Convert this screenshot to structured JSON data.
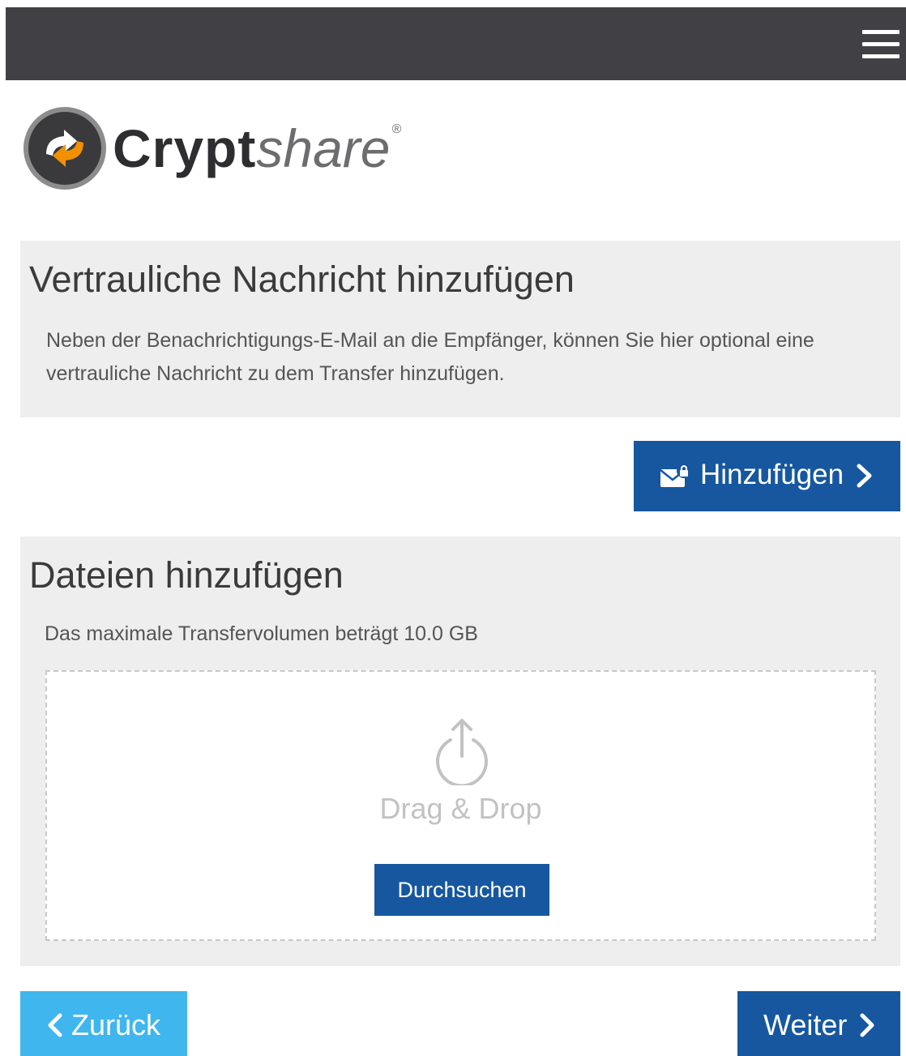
{
  "header": {
    "menu_icon": "hamburger-menu-icon",
    "background": "#414145"
  },
  "logo": {
    "brand_bold": "Crypt",
    "brand_light": "share",
    "registered": "®",
    "mark_icon": "cryptshare-logo-icon"
  },
  "message_section": {
    "title": "Vertrauliche Nachricht hinzufügen",
    "description": "Neben der Benachrichtigungs-E-Mail an die Empfänger, können Sie hier optional eine vertrauliche Nachricht zu dem Transfer hinzufügen.",
    "add_button": {
      "label": "Hinzufügen",
      "icon": "envelope-lock-icon",
      "chevron": "chevron-right-icon"
    }
  },
  "files_section": {
    "title": "Dateien hinzufügen",
    "description": "Das maximale Transfervolumen beträgt 10.0 GB",
    "dropzone": {
      "icon": "upload-icon",
      "text": "Drag & Drop",
      "browse_label": "Durchsuchen"
    }
  },
  "footer_nav": {
    "back_label": "Zurück",
    "next_label": "Weiter"
  },
  "colors": {
    "primary": "#1657a0",
    "back_button": "#3fb6ee",
    "panel_bg": "#eeeeee",
    "logo_orange": "#f29100"
  }
}
